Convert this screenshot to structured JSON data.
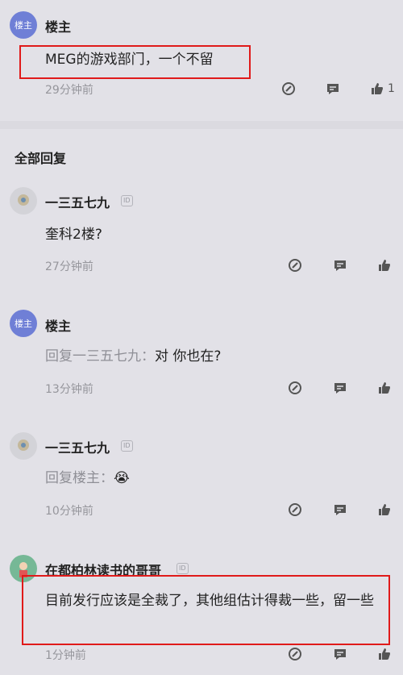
{
  "top_post": {
    "avatar_label": "楼主",
    "name": "楼主",
    "content": "MEG的游戏部门，一个不留",
    "time": "29分钟前",
    "like_count": "1"
  },
  "section_title": "全部回复",
  "replies": [
    {
      "name": "一三五七九",
      "badge": "ID",
      "content": "奎科2楼?",
      "reply_prefix": "",
      "time": "27分钟前"
    },
    {
      "avatar_label": "楼主",
      "name": "楼主",
      "reply_prefix": "回复一三五七九：",
      "content": "对 你也在?",
      "time": "13分钟前"
    },
    {
      "name": "一三五七九",
      "badge": "ID",
      "reply_prefix": "回复楼主：",
      "content": "😭",
      "time": "10分钟前"
    },
    {
      "name": "在都柏林读书的哥哥",
      "badge": "ID",
      "content": "目前发行应该是全裁了，其他组估计得裁一些，留一些",
      "reply_prefix": "",
      "time": "1分钟前"
    }
  ],
  "colors": {
    "highlight_box": "#e01a1a",
    "owner_avatar": "#6f7fd6"
  },
  "icons": [
    "edit-icon",
    "comment-icon",
    "thumbs-up-icon"
  ]
}
